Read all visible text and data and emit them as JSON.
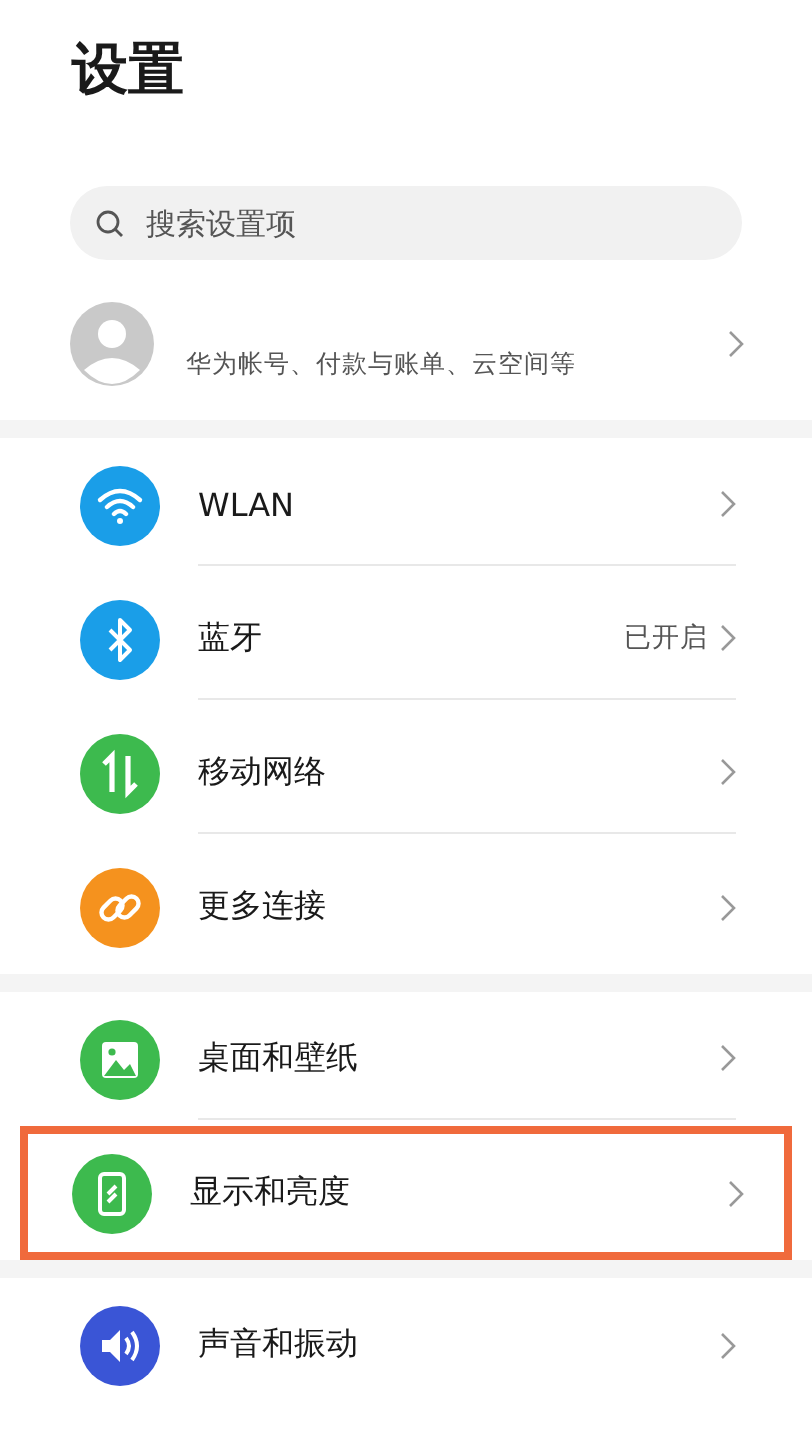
{
  "title": "设置",
  "search": {
    "placeholder": "搜索设置项"
  },
  "account": {
    "subtitle": "华为帐号、付款与账单、云空间等"
  },
  "groups": [
    {
      "items": [
        {
          "label": "WLAN",
          "kind": "wifi",
          "color": "#1a9ee8",
          "highlighted": false
        },
        {
          "label": "蓝牙",
          "status": "已开启",
          "kind": "bluetooth",
          "color": "#1a9ee8",
          "highlighted": false
        },
        {
          "label": "移动网络",
          "kind": "arrows",
          "color": "#3dba4e",
          "highlighted": false
        },
        {
          "label": "更多连接",
          "kind": "link",
          "color": "#f5921e",
          "highlighted": false
        }
      ]
    },
    {
      "items": [
        {
          "label": "桌面和壁纸",
          "kind": "image",
          "color": "#3dba4e",
          "highlighted": false
        },
        {
          "label": "显示和亮度",
          "kind": "phone",
          "color": "#3dba4e",
          "highlighted": true
        }
      ]
    },
    {
      "items": [
        {
          "label": "声音和振动",
          "kind": "speaker",
          "color": "#3a55d6",
          "highlighted": false
        }
      ]
    }
  ]
}
